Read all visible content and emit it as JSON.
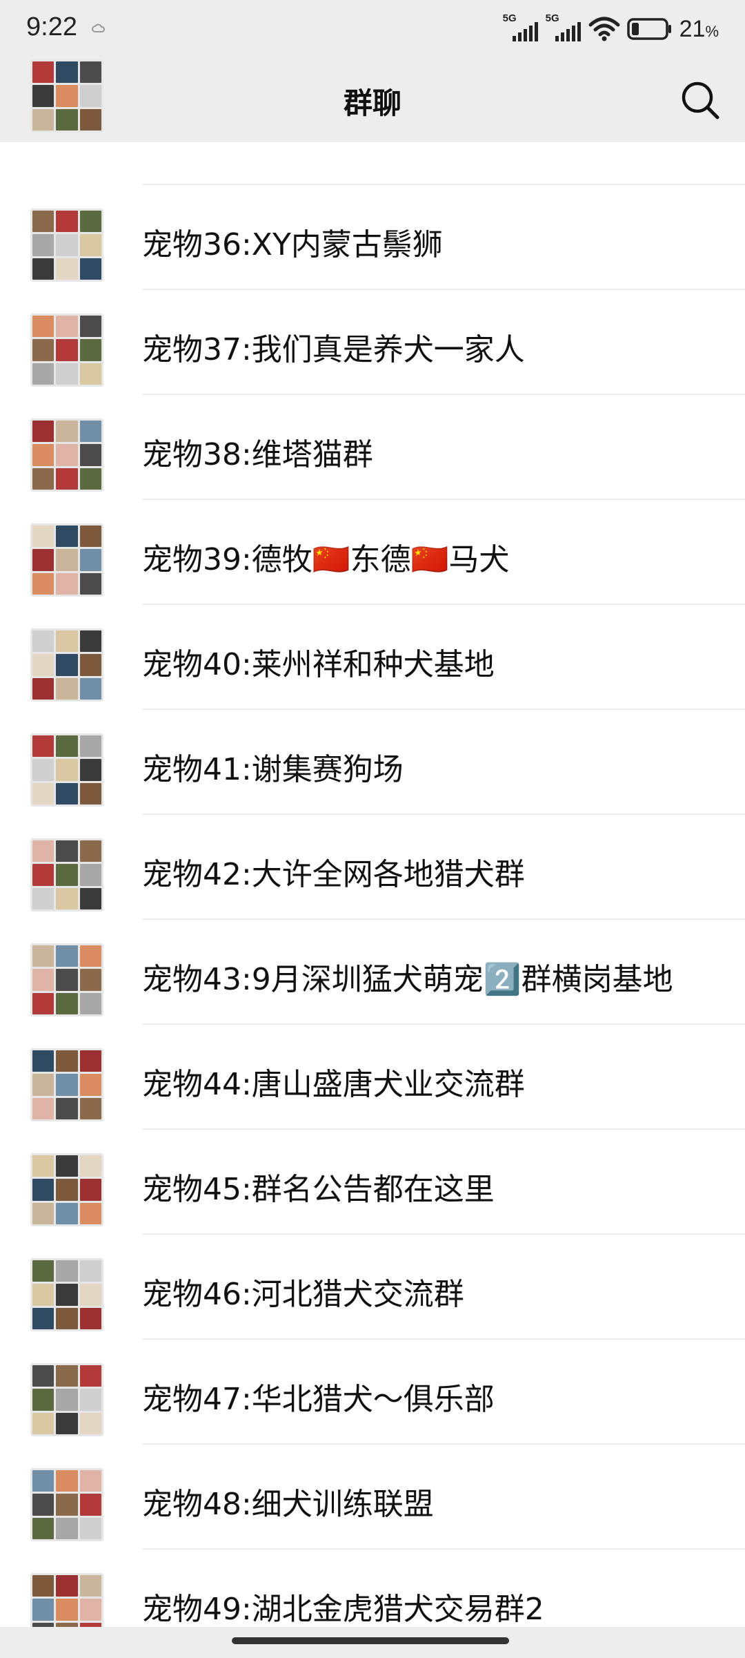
{
  "status_bar": {
    "time": "9:22",
    "signal1_label": "5G",
    "signal2_label": "5G",
    "battery_percent": "21",
    "battery_unit": "%",
    "battery_level": 0.21,
    "icons": [
      "cloud-icon",
      "signal-icon",
      "signal-icon",
      "wifi-icon",
      "battery-icon"
    ]
  },
  "nav": {
    "title": "群聊",
    "back_icon": "back-chevron-icon",
    "search_icon": "search-icon"
  },
  "groups": [
    {
      "name": "宠物36:XY内蒙古鬃狮"
    },
    {
      "name": "宠物37:我们真是养犬一家人"
    },
    {
      "name": "宠物38:维塔猫群"
    },
    {
      "name": "宠物39:德牧🇨🇳东德🇨🇳马犬"
    },
    {
      "name": "宠物40:莱州祥和种犬基地"
    },
    {
      "name": "宠物41:谢集赛狗场"
    },
    {
      "name": "宠物42:大许全网各地猎犬群"
    },
    {
      "name": "宠物43:9月深圳猛犬萌宠2️⃣群横岗基地"
    },
    {
      "name": "宠物44:唐山盛唐犬业交流群"
    },
    {
      "name": "宠物45:群名公告都在这里"
    },
    {
      "name": "宠物46:河北猎犬交流群"
    },
    {
      "name": "宠物47:华北猎犬～俱乐部"
    },
    {
      "name": "宠物48:细犬训练联盟"
    },
    {
      "name": "宠物49:湖北金虎猎犬交易群2"
    }
  ],
  "colors": {
    "header_bg": "#ededed",
    "list_bg": "#ffffff",
    "divider": "#ededed",
    "text": "#111111"
  }
}
